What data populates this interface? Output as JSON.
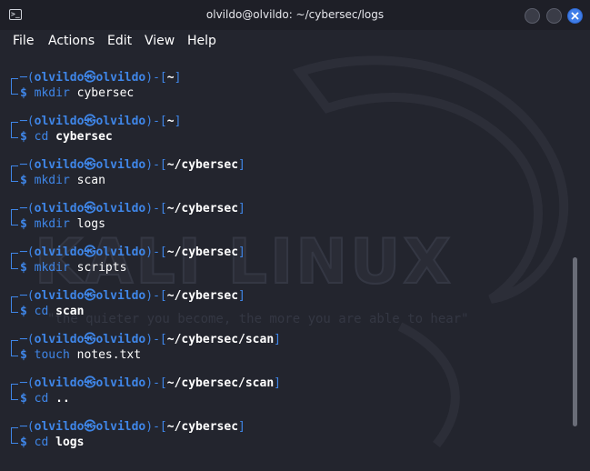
{
  "window": {
    "title": "olvildo@olvildo: ~/cybersec/logs",
    "app_icon_glyph": ">_"
  },
  "menu": [
    "File",
    "Actions",
    "Edit",
    "View",
    "Help"
  ],
  "watermark": {
    "title": "KALI LINUX",
    "tagline": "\"the quieter you become, the more you are able to hear\""
  },
  "prompt": {
    "user": "olvildo",
    "host": "olvildo",
    "separator": "㉿"
  },
  "entries": [
    {
      "dir": "~",
      "cmd": "mkdir",
      "arg": "cybersec",
      "arg_bold": false
    },
    {
      "dir": "~",
      "cmd": "cd",
      "arg": "cybersec",
      "arg_bold": true
    },
    {
      "dir": "~/cybersec",
      "cmd": "mkdir",
      "arg": "scan",
      "arg_bold": false
    },
    {
      "dir": "~/cybersec",
      "cmd": "mkdir",
      "arg": "logs",
      "arg_bold": false
    },
    {
      "dir": "~/cybersec",
      "cmd": "mkdir",
      "arg": "scripts",
      "arg_bold": false
    },
    {
      "dir": "~/cybersec",
      "cmd": "cd",
      "arg": "scan",
      "arg_bold": true
    },
    {
      "dir": "~/cybersec/scan",
      "cmd": "touch",
      "arg": "notes.txt",
      "arg_bold": false
    },
    {
      "dir": "~/cybersec/scan",
      "cmd": "cd",
      "arg": "..",
      "arg_bold": true
    },
    {
      "dir": "~/cybersec",
      "cmd": "cd",
      "arg": "logs",
      "arg_bold": true
    }
  ],
  "colors": {
    "background": "#23252e",
    "prompt_blue": "#3f86e8",
    "text": "#ffffff",
    "close_button": "#3f7de8"
  }
}
